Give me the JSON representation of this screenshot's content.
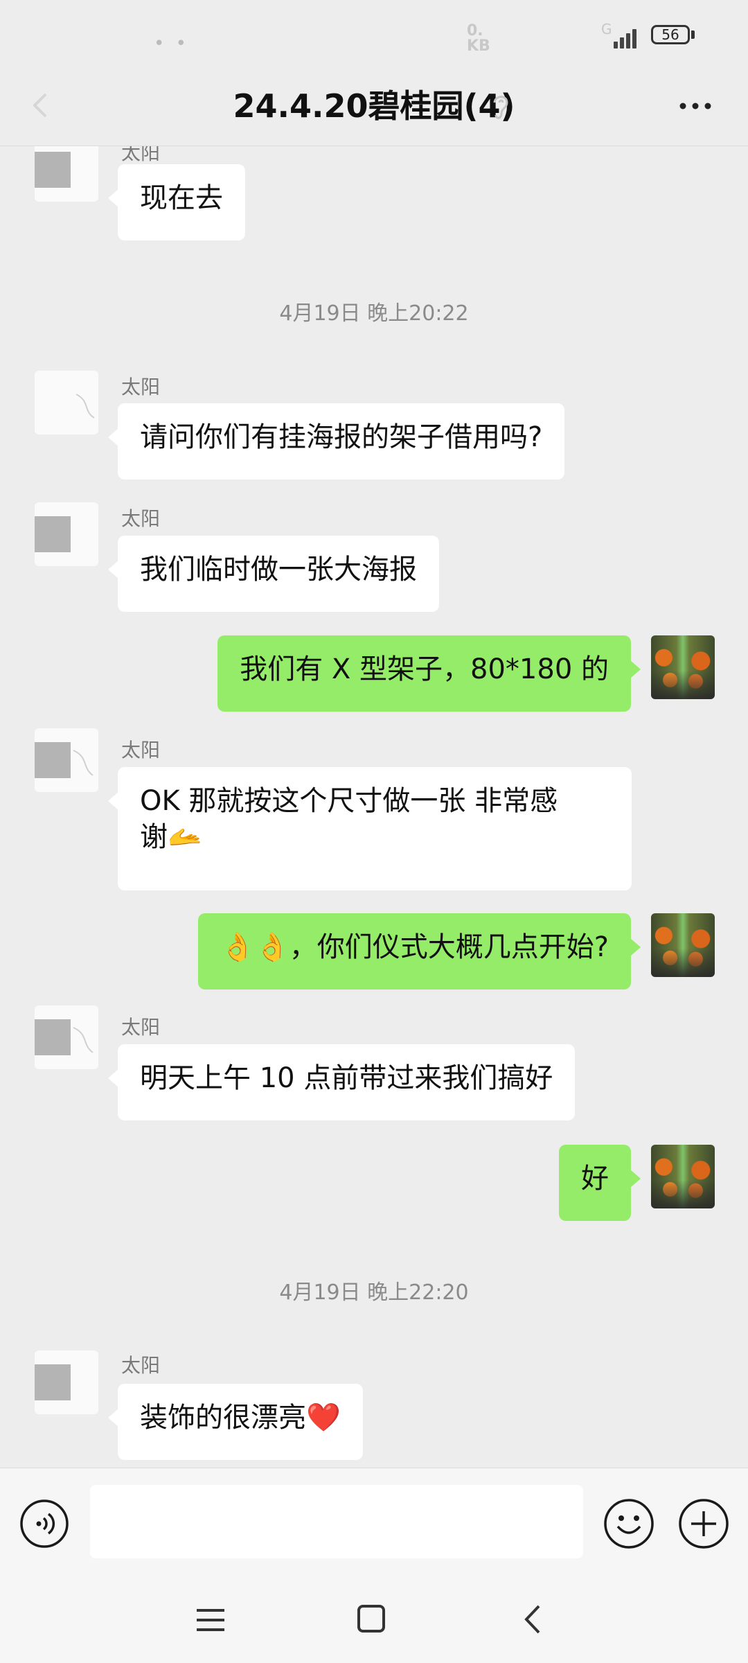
{
  "status_bar": {
    "net_speed_line1": "0.",
    "net_speed_line2": "KB",
    "signal_label": "G",
    "battery": "56"
  },
  "header": {
    "title": "24.4.20碧桂园(4)"
  },
  "messages": [
    {
      "sender": "太阳",
      "text": "现在去"
    },
    {
      "timestamp": "4月19日 晚上20:22"
    },
    {
      "sender": "太阳",
      "text": "请问你们有挂海报的架子借用吗?"
    },
    {
      "sender": "太阳",
      "text": "我们临时做一张大海报"
    },
    {
      "text": "我们有 X 型架子，80*180 的"
    },
    {
      "sender": "太阳",
      "text_line1": "OK 那就按这个尺寸做一张 非常感",
      "text_line2": "谢🫴"
    },
    {
      "text": "👌👌，你们仪式大概几点开始?"
    },
    {
      "sender": "太阳",
      "text": "明天上午 10 点前带过来我们搞好"
    },
    {
      "text": "好"
    },
    {
      "timestamp": "4月19日 晚上22:20"
    },
    {
      "sender": "太阳",
      "text": "装饰的很漂亮❤️"
    }
  ],
  "input": {
    "placeholder": ""
  },
  "colors": {
    "background": "#ededed",
    "incoming_bubble": "#ffffff",
    "outgoing_bubble": "#95ec69",
    "timestamp": "#8a8a8a"
  },
  "icons": [
    "back-icon",
    "ear-icon",
    "more-icon",
    "voice-icon",
    "emoji-icon",
    "plus-icon",
    "nav-menu-icon",
    "nav-home-icon",
    "nav-back-icon"
  ]
}
